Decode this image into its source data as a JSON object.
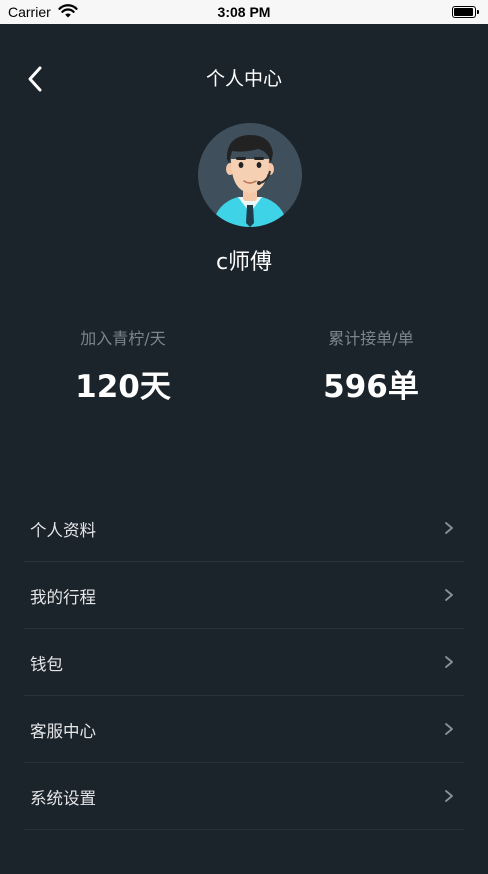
{
  "status_bar": {
    "carrier": "Carrier",
    "time": "3:08 PM"
  },
  "header": {
    "title": "个人中心"
  },
  "profile": {
    "name": "c师傅"
  },
  "stats": [
    {
      "label": "加入青柠/天",
      "value": "120天"
    },
    {
      "label": "累计接单/单",
      "value": "596单"
    }
  ],
  "menu": [
    {
      "label": "个人资料"
    },
    {
      "label": "我的行程"
    },
    {
      "label": "钱包"
    },
    {
      "label": "客服中心"
    },
    {
      "label": "系统设置"
    }
  ],
  "colors": {
    "background": "#1b232b",
    "divider": "#2a333c",
    "muted_text": "#7c858e",
    "text": "#ffffff",
    "avatar_bg": "#3f4f5b",
    "shirt": "#3fd3e8"
  },
  "icons": {
    "back": "chevron-left-icon",
    "menu_chevron": "chevron-right-icon",
    "wifi": "wifi-icon",
    "battery": "battery-icon"
  }
}
